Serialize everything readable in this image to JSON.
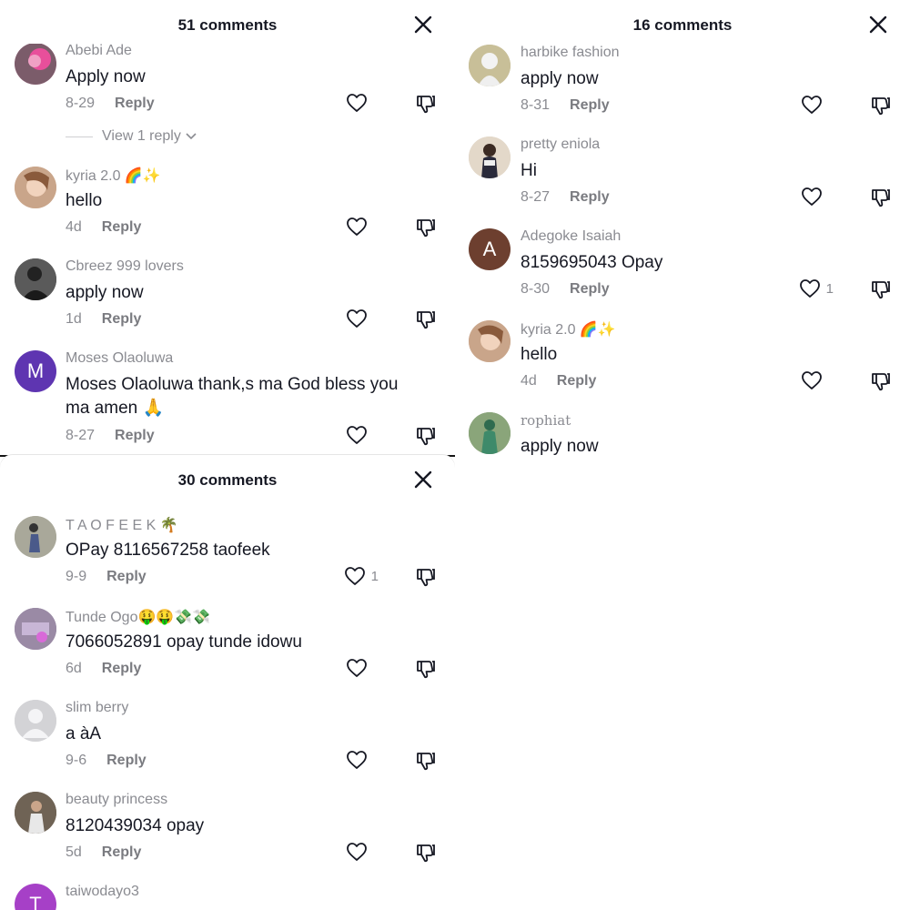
{
  "panels": [
    {
      "title": "51 comments",
      "comments": [
        {
          "user": "Abebi Ade",
          "text": "Apply now",
          "date": "8-29",
          "reply": "Reply",
          "likes": "",
          "avatar": "pink-photo"
        },
        {
          "user": "kyria 2.0 🌈✨",
          "text": "hello",
          "date": "4d",
          "reply": "Reply",
          "likes": "",
          "avatar": "photo"
        },
        {
          "user": "Cbreez 999 lovers",
          "text": "apply now",
          "date": "1d",
          "reply": "Reply",
          "likes": "",
          "avatar": "dark-photo"
        },
        {
          "user": "Moses Olaoluwa",
          "text": "Moses Olaoluwa thank,s ma God bless you ma amen 🙏",
          "date": "8-27",
          "reply": "Reply",
          "likes": "",
          "avatar": "M"
        }
      ],
      "view_replies": "View 1 reply"
    },
    {
      "title": "16 comments",
      "comments": [
        {
          "user": "harbike fashion",
          "text": "apply now",
          "date": "8-31",
          "reply": "Reply",
          "likes": "",
          "avatar": "photo"
        },
        {
          "user": "pretty eniola",
          "text": "Hi",
          "date": "8-27",
          "reply": "Reply",
          "likes": "",
          "avatar": "photo"
        },
        {
          "user": "Adegoke Isaiah",
          "text": "8159695043 Opay",
          "date": "8-30",
          "reply": "Reply",
          "likes": "1",
          "avatar": "A"
        },
        {
          "user": "kyria 2.0 🌈✨",
          "text": "hello",
          "date": "4d",
          "reply": "Reply",
          "likes": "",
          "avatar": "photo"
        },
        {
          "user": "rophiat",
          "text": "apply now",
          "date": "",
          "reply": "",
          "likes": "",
          "avatar": "photo"
        }
      ]
    },
    {
      "title": "30 comments",
      "comments": [
        {
          "user": "T A O F E E K 🌴",
          "text": "OPay 8116567258 taofeek",
          "date": "9-9",
          "reply": "Reply",
          "likes": "1",
          "avatar": "photo"
        },
        {
          "user": "Tunde Ogo🤑🤑💸💸",
          "text": "7066052891 opay tunde idowu",
          "date": "6d",
          "reply": "Reply",
          "likes": "",
          "avatar": "photo"
        },
        {
          "user": "slim berry",
          "text": "a àA",
          "date": "9-6",
          "reply": "Reply",
          "likes": "",
          "avatar": "default"
        },
        {
          "user": "beauty princess",
          "text": "8120439034 opay",
          "date": "5d",
          "reply": "Reply",
          "likes": "",
          "avatar": "photo"
        },
        {
          "user": "taiwodayo3",
          "text": "",
          "date": "",
          "reply": "",
          "likes": "",
          "avatar": "T"
        }
      ]
    }
  ],
  "colors": {
    "avatar_m": "#5e35b1",
    "avatar_a": "#6d3f2f",
    "avatar_t": "#a640c7"
  }
}
